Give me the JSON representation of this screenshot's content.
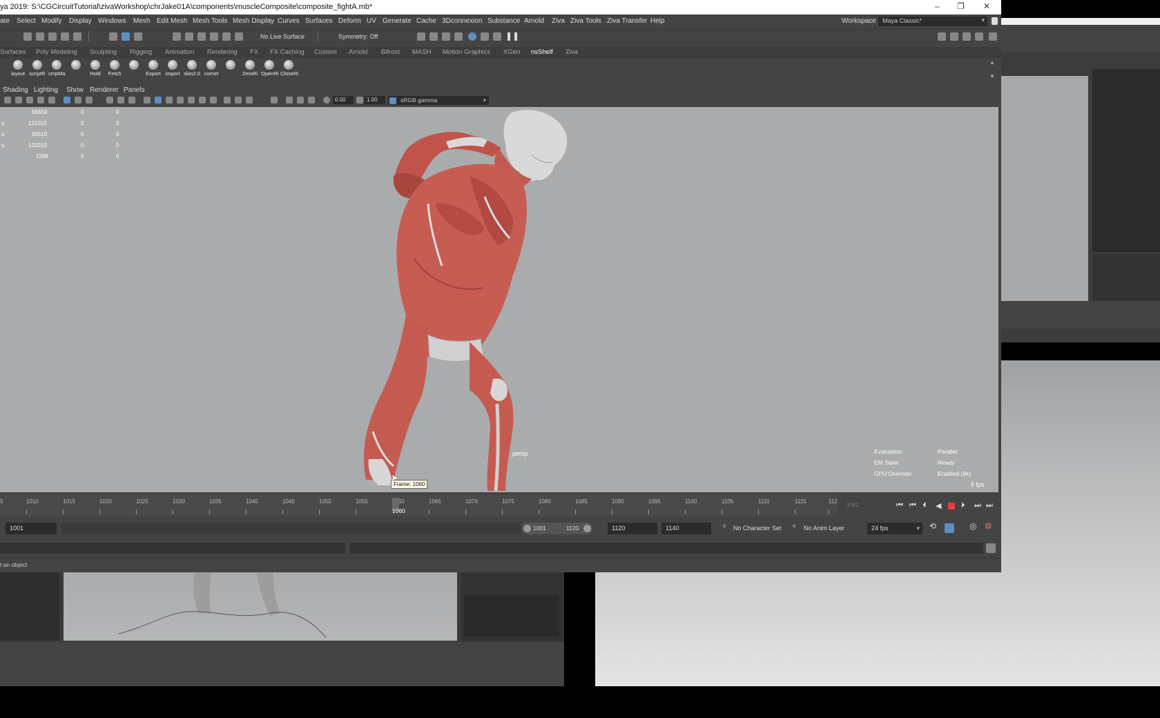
{
  "window": {
    "title": "ya 2019: S:\\CGCircuitTutorial\\zivaWorkshop\\chrJake01A\\components\\muscleComposite\\composite_fightA.mb*",
    "controls": [
      "–",
      "❐",
      "✕"
    ]
  },
  "menubar": {
    "items": [
      "ate",
      "Select",
      "Modify",
      "Display",
      "Windows",
      "Mesh",
      "Edit Mesh",
      "Mesh Tools",
      "Mesh Display",
      "Curves",
      "Surfaces",
      "Deform",
      "UV",
      "Generate",
      "Cache",
      "3Dconnexion",
      "Substance",
      "Arnold",
      "Ziva",
      "Ziva Tools",
      "Ziva Transfer",
      "Help"
    ],
    "workspace_label": "Workspace :",
    "workspace_value": "Maya Classic*"
  },
  "statusline": {
    "live_surface": "No Live Surface",
    "symmetry": "Symmetry: Off"
  },
  "shelf": {
    "tabs": [
      "Surfaces",
      "Poly Modeling",
      "Sculpting",
      "Rigging",
      "Animation",
      "Rendering",
      "FX",
      "FX Caching",
      "Custom",
      "Arnold",
      "Bifrost",
      "MASH",
      "Motion Graphics",
      "XGen",
      "nsShelf",
      "Ziva"
    ],
    "active_tab": "nsShelf",
    "buttons": [
      "layout",
      "scriptR",
      "cmpMa",
      "",
      "Hold",
      "Fetch",
      "",
      "Export",
      "import",
      "skin2.0",
      "comet",
      "",
      "ZeroRi",
      "OpenRi",
      "CloseRi"
    ]
  },
  "panel": {
    "menus": [
      "Shading",
      "Lighting",
      "Show",
      "Renderer",
      "Panels"
    ],
    "exposure": "0.00",
    "gamma": "1.00",
    "color_space": "sRGB gamma"
  },
  "viewport": {
    "camera_label": "persp",
    "hud_stats": [
      {
        "label": "",
        "a": "65659",
        "b": "0",
        "c": "0"
      },
      {
        "label": "s:",
        "a": "131015",
        "b": "0",
        "c": "0"
      },
      {
        "label": "s:",
        "a": "65510",
        "b": "0",
        "c": "0"
      },
      {
        "label": "s:",
        "a": "131010",
        "b": "0",
        "c": "0"
      },
      {
        "label": "",
        "a": "1596",
        "b": "0",
        "c": "0"
      }
    ],
    "hud_eval": [
      {
        "label": "Evaluation:",
        "value": "Parallel"
      },
      {
        "label": "EM State:",
        "value": "Ready"
      },
      {
        "label": "GPU Override:",
        "value": "Enabled (8k)"
      }
    ],
    "fps": "6 fps",
    "tooltip": "Frame: 1060"
  },
  "timeslider": {
    "ticks": [
      "5",
      "1010",
      "1015",
      "1020",
      "1025",
      "1030",
      "1035",
      "1040",
      "1045",
      "1050",
      "1055",
      "1060",
      "1065",
      "1070",
      "1075",
      "1080",
      "1085",
      "1090",
      "1095",
      "1100",
      "1105",
      "1110",
      "1115",
      "112"
    ],
    "current_frame": "1060",
    "current_field": "1062"
  },
  "rangeslider": {
    "start": "1001",
    "range_start": "1001",
    "range_end": "1120",
    "end": "1120",
    "anim_end": "1140",
    "character_set": "No Character Set",
    "anim_layer": "No Anim Layer",
    "fps": "24 fps"
  },
  "helpline": {
    "text": "t an object"
  },
  "colors": {
    "muscle": "#c45a52",
    "viewport_bg": "#a9abac",
    "accent": "#5b8fbf",
    "record": "#e04040"
  }
}
